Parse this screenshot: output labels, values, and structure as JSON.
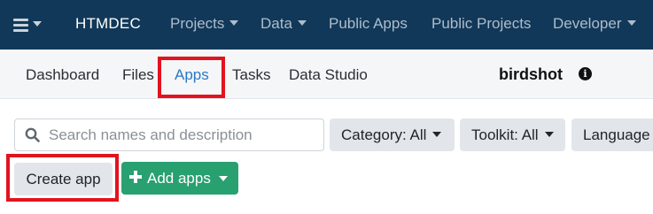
{
  "topnav": {
    "brand": "HTMDEC",
    "items": [
      {
        "label": "Projects",
        "dropdown": true
      },
      {
        "label": "Data",
        "dropdown": true
      },
      {
        "label": "Public Apps",
        "dropdown": false
      },
      {
        "label": "Public Projects",
        "dropdown": false
      },
      {
        "label": "Developer",
        "dropdown": true
      }
    ],
    "menu_icon": "hamburger-icon"
  },
  "subnav": {
    "tabs": [
      {
        "label": "Dashboard",
        "active": false
      },
      {
        "label": "Files",
        "active": false
      },
      {
        "label": "Apps",
        "active": true
      },
      {
        "label": "Tasks",
        "active": false
      },
      {
        "label": "Data Studio",
        "active": false
      }
    ],
    "project_name": "birdshot",
    "info_icon": "info-icon",
    "info_glyph": "i"
  },
  "filters": {
    "search_placeholder": "Search names and description",
    "search_value": "",
    "category": "Category: All",
    "toolkit": "Toolkit: All",
    "language": "Language"
  },
  "actions": {
    "create_label": "Create app",
    "add_label": "Add apps"
  },
  "colors": {
    "navbar_bg": "#113858",
    "subnav_bg": "#f4f6f8",
    "active_tab": "#2b78c4",
    "add_button": "#28a070",
    "highlight": "#e1141e"
  }
}
